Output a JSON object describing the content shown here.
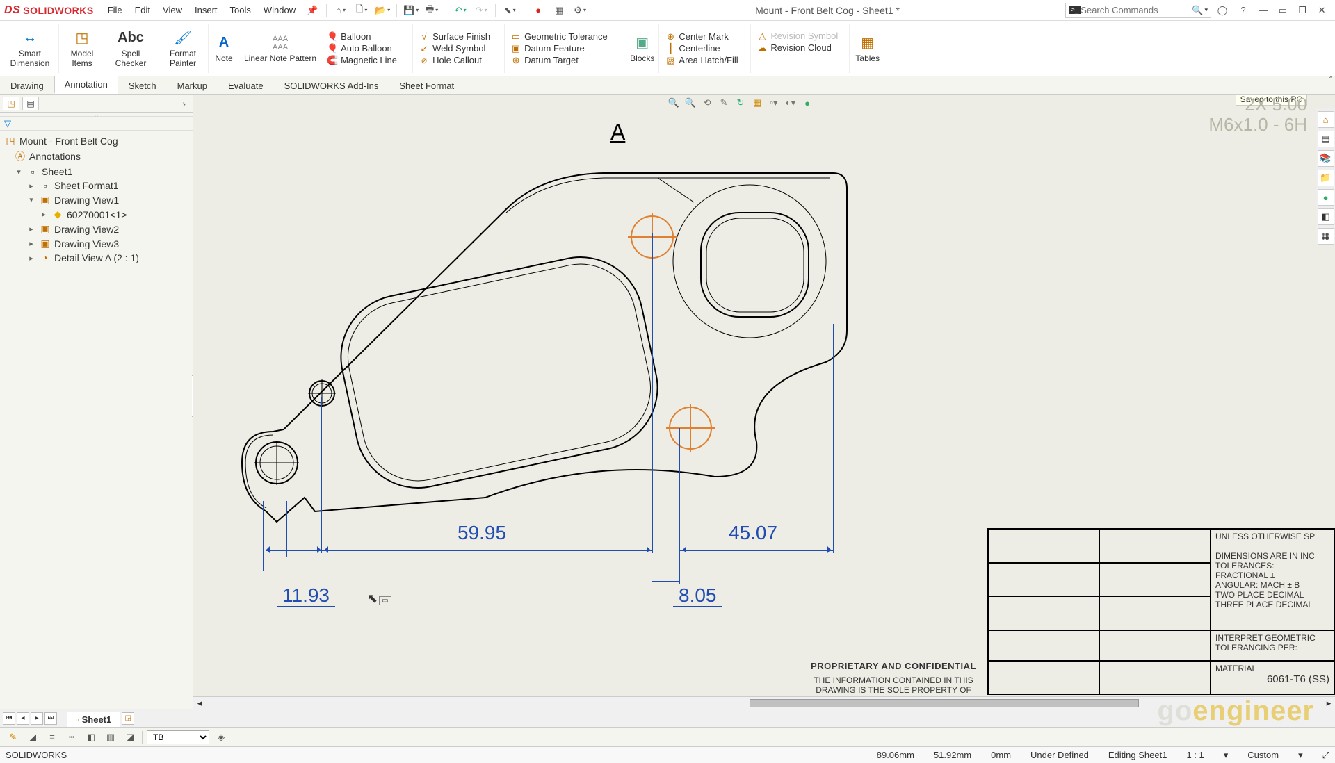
{
  "app_name": "SOLIDWORKS",
  "doc_title": "Mount - Front Belt Cog - Sheet1 *",
  "menu": [
    "File",
    "Edit",
    "View",
    "Insert",
    "Tools",
    "Window"
  ],
  "search_placeholder": "Search Commands",
  "ribbon": {
    "smart_dimension": "Smart Dimension",
    "model_items": "Model Items",
    "spell_checker": "Spell Checker",
    "format_painter": "Format Painter",
    "note": "Note",
    "linear_note_pattern": "Linear Note Pattern",
    "balloon": "Balloon",
    "auto_balloon": "Auto Balloon",
    "magnetic_line": "Magnetic Line",
    "surface_finish": "Surface Finish",
    "weld_symbol": "Weld Symbol",
    "hole_callout": "Hole Callout",
    "geometric_tolerance": "Geometric Tolerance",
    "datum_feature": "Datum Feature",
    "datum_target": "Datum Target",
    "blocks": "Blocks",
    "center_mark": "Center Mark",
    "centerline": "Centerline",
    "area_hatch": "Area Hatch/Fill",
    "revision_symbol": "Revision Symbol",
    "revision_cloud": "Revision Cloud",
    "tables": "Tables"
  },
  "cm_tabs": [
    "Drawing",
    "Annotation",
    "Sketch",
    "Markup",
    "Evaluate",
    "SOLIDWORKS Add-Ins",
    "Sheet Format"
  ],
  "cm_active": 1,
  "tree": {
    "root": "Mount - Front Belt Cog",
    "annotations": "Annotations",
    "sheet": "Sheet1",
    "sheet_format": "Sheet Format1",
    "dv1": "Drawing View1",
    "part_ref": "60270001<1>",
    "dv2": "Drawing View2",
    "dv3": "Drawing View3",
    "detail": "Detail View A (2 : 1)"
  },
  "saved_tip": "Saved to this PC",
  "dimensions": {
    "d1": "11.93",
    "d2": "59.95",
    "d3": "8.05",
    "d4": "45.07"
  },
  "detail_label": "A",
  "corner_note1": "2X   5.00",
  "corner_note2": "M6x1.0 - 6H",
  "title_block": {
    "prop_hdr": "PROPRIETARY AND CONFIDENTIAL",
    "prop_body": "THE INFORMATION CONTAINED IN THIS DRAWING IS THE SOLE PROPERTY OF",
    "unless": "UNLESS OTHERWISE SP",
    "dims_in": "DIMENSIONS ARE IN INC",
    "tolerances": "TOLERANCES:",
    "fractional": "FRACTIONAL ±",
    "angular": "ANGULAR: MACH ±     B",
    "two_place": "TWO PLACE DECIMAL",
    "three_place": "THREE PLACE DECIMAL",
    "interpret": "INTERPRET GEOMETRIC",
    "tol_per": "TOLERANCING PER:",
    "material": "MATERIAL",
    "mat_val": "6061-T6 (SS)"
  },
  "sheet_tab": "Sheet1",
  "layer_select": "TB",
  "status": {
    "app": "SOLIDWORKS",
    "x": "89.06mm",
    "y": "51.92mm",
    "z": "0mm",
    "state": "Under Defined",
    "editing": "Editing Sheet1",
    "scale": "1 : 1",
    "custom": "Custom"
  },
  "watermark": "goengineer"
}
